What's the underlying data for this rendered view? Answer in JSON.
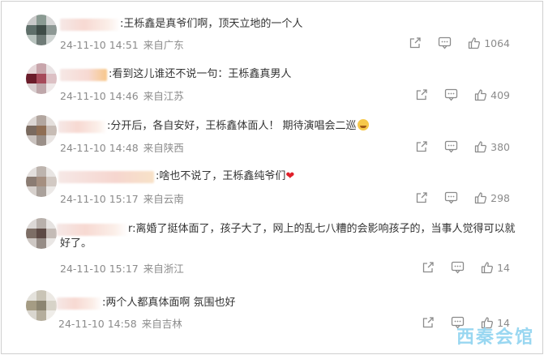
{
  "comments": [
    {
      "text": ":王栎鑫是真爷们啊，顶天立地的一个人",
      "time": "24-11-10 14:51",
      "location": "来自广东",
      "likes": "1064"
    },
    {
      "text": ":看到这儿谁还不说一句：王栎鑫真男人",
      "time": "24-11-10 14:46",
      "location": "来自江苏",
      "likes": "409"
    },
    {
      "text": ":分开后，各自安好，王栎鑫体面人！ 期待演唱会二巡",
      "time": "24-11-10 14:48",
      "location": "来自陕西",
      "likes": "380"
    },
    {
      "text": ":啥也不说了，王栎鑫纯爷们",
      "time": "24-11-10 15:17",
      "location": "来自云南",
      "likes": "298"
    },
    {
      "text": "r:离婚了挺体面了，孩子大了，网上的乱七八糟的会影响孩子的，当事人觉得可以就好了。",
      "time": "24-11-10 15:17",
      "location": "来自浙江",
      "likes": "14"
    },
    {
      "text": ":两个人都真体面啊 氛围也好",
      "time": "24-11-10 14:58",
      "location": "来自吉林",
      "likes": "14"
    }
  ],
  "watermark": "西秦会馆",
  "colors": {
    "meta_text": "#8b8b8b",
    "body_text": "#333333",
    "heart": "#e0202a",
    "watermark": "#8fd3f0"
  },
  "icons": [
    "share-icon",
    "reply-icon",
    "like-icon",
    "heart-emoji",
    "smile-emoji"
  ]
}
